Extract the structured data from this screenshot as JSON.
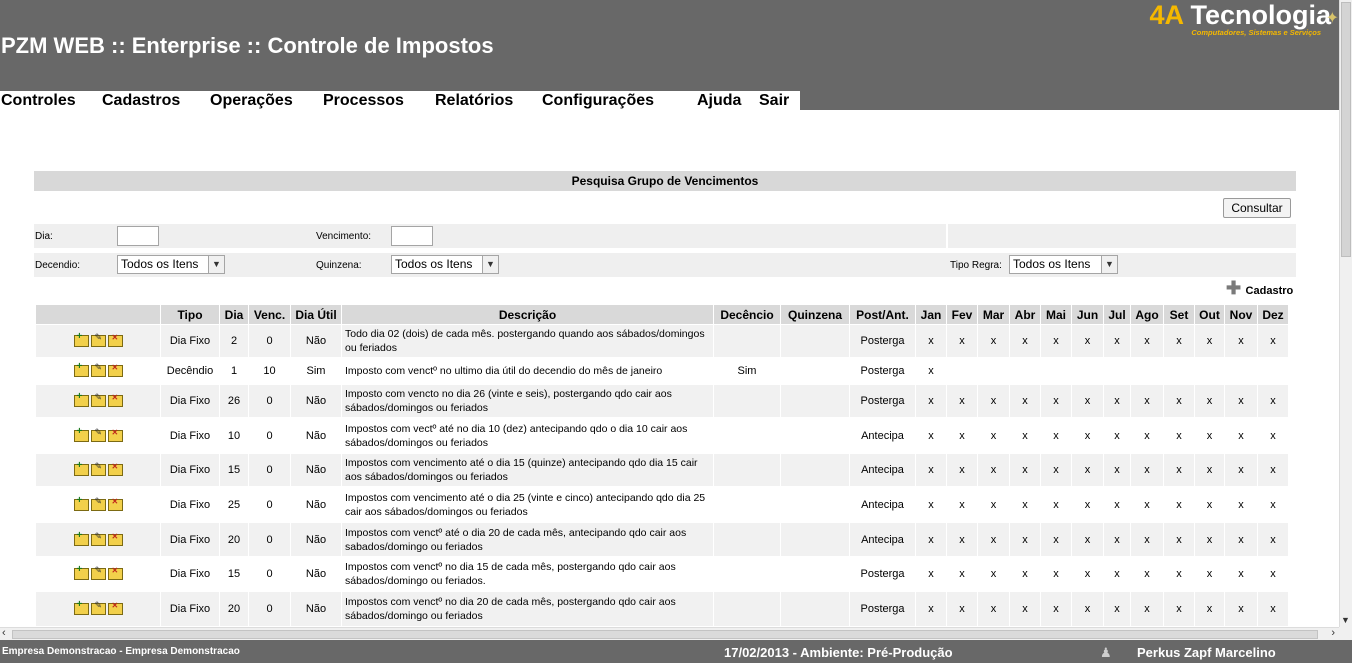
{
  "header": {
    "app_title": "PZM WEB :: Enterprise :: Controle de Impostos",
    "logo_prefix": "4A",
    "logo_name": "Tecnologia",
    "logo_tagline": "Computadores, Sistemas e Serviços"
  },
  "menu": [
    "Controles",
    "Cadastros",
    "Operações",
    "Processos",
    "Relatórios",
    "Configurações",
    "Ajuda",
    "Sair"
  ],
  "panel": {
    "title": "Pesquisa Grupo de Vencimentos",
    "consultar_label": "Consultar",
    "cadastro_label": "Cadastro"
  },
  "filters": {
    "dia_label": "Dia:",
    "dia_value": "",
    "vencimento_label": "Vencimento:",
    "vencimento_value": "",
    "decendio_label": "Decendio:",
    "decendio_value": "Todos os Itens",
    "quinzena_label": "Quinzena:",
    "quinzena_value": "Todos os Itens",
    "tipo_regra_label": "Tipo Regra:",
    "tipo_regra_value": "Todos os Itens"
  },
  "table": {
    "columns": [
      "",
      "Tipo",
      "Dia",
      "Venc.",
      "Dia Útil",
      "Descrição",
      "Decêncio",
      "Quinzena",
      "Post/Ant.",
      "Jan",
      "Fev",
      "Mar",
      "Abr",
      "Mai",
      "Jun",
      "Jul",
      "Ago",
      "Set",
      "Out",
      "Nov",
      "Dez"
    ],
    "rows": [
      {
        "tipo": "Dia Fixo",
        "dia": "2",
        "venc": "0",
        "dia_util": "Não",
        "desc": "Todo dia 02 (dois) de cada mês. postergando quando aos sábados/domingos ou feriados",
        "decendio": "",
        "quinzena": "",
        "post_ant": "Posterga",
        "months": [
          "x",
          "x",
          "x",
          "x",
          "x",
          "x",
          "x",
          "x",
          "x",
          "x",
          "x",
          "x"
        ]
      },
      {
        "tipo": "Decêndio",
        "dia": "1",
        "venc": "10",
        "dia_util": "Sim",
        "desc": "Imposto com venctº no ultimo dia útil do decendio do mês de janeiro",
        "decendio": "Sim",
        "quinzena": "",
        "post_ant": "Posterga",
        "months": [
          "x",
          "",
          "",
          "",
          "",
          "",
          "",
          "",
          "",
          "",
          "",
          ""
        ]
      },
      {
        "tipo": "Dia Fixo",
        "dia": "26",
        "venc": "0",
        "dia_util": "Não",
        "desc": "Imposto com vencto no dia 26 (vinte e seis), postergando qdo cair aos sábados/domingos ou feriados",
        "decendio": "",
        "quinzena": "",
        "post_ant": "Posterga",
        "months": [
          "x",
          "x",
          "x",
          "x",
          "x",
          "x",
          "x",
          "x",
          "x",
          "x",
          "x",
          "x"
        ]
      },
      {
        "tipo": "Dia Fixo",
        "dia": "10",
        "venc": "0",
        "dia_util": "Não",
        "desc": "Impostos com vectº até no dia 10 (dez) antecipando qdo o dia 10 cair aos sábados/domingos ou feriados",
        "decendio": "",
        "quinzena": "",
        "post_ant": "Antecipa",
        "months": [
          "x",
          "x",
          "x",
          "x",
          "x",
          "x",
          "x",
          "x",
          "x",
          "x",
          "x",
          "x"
        ]
      },
      {
        "tipo": "Dia Fixo",
        "dia": "15",
        "venc": "0",
        "dia_util": "Não",
        "desc": "Impostos com vencimento até o dia 15 (quinze) antecipando qdo dia 15 cair aos sábados/domingos ou feriados",
        "decendio": "",
        "quinzena": "",
        "post_ant": "Antecipa",
        "months": [
          "x",
          "x",
          "x",
          "x",
          "x",
          "x",
          "x",
          "x",
          "x",
          "x",
          "x",
          "x"
        ]
      },
      {
        "tipo": "Dia Fixo",
        "dia": "25",
        "venc": "0",
        "dia_util": "Não",
        "desc": "Impostos com vencimento até o dia 25 (vinte e cinco) antecipando qdo dia 25 cair aos sábados/domingos ou feriados",
        "decendio": "",
        "quinzena": "",
        "post_ant": "Antecipa",
        "months": [
          "x",
          "x",
          "x",
          "x",
          "x",
          "x",
          "x",
          "x",
          "x",
          "x",
          "x",
          "x"
        ]
      },
      {
        "tipo": "Dia Fixo",
        "dia": "20",
        "venc": "0",
        "dia_util": "Não",
        "desc": "Impostos com venctº até o dia 20 de cada mês, antecipando qdo cair aos sabados/domingo ou feriados",
        "decendio": "",
        "quinzena": "",
        "post_ant": "Antecipa",
        "months": [
          "x",
          "x",
          "x",
          "x",
          "x",
          "x",
          "x",
          "x",
          "x",
          "x",
          "x",
          "x"
        ]
      },
      {
        "tipo": "Dia Fixo",
        "dia": "15",
        "venc": "0",
        "dia_util": "Não",
        "desc": "Impostos com venctº no dia 15 de cada mês, postergando qdo cair aos sábados/domingo ou feriados.",
        "decendio": "",
        "quinzena": "",
        "post_ant": "Posterga",
        "months": [
          "x",
          "x",
          "x",
          "x",
          "x",
          "x",
          "x",
          "x",
          "x",
          "x",
          "x",
          "x"
        ]
      },
      {
        "tipo": "Dia Fixo",
        "dia": "20",
        "venc": "0",
        "dia_util": "Não",
        "desc": "Impostos com venctº no dia 20 de cada mês, postergando qdo cair aos sábados/domingo ou feriados",
        "decendio": "",
        "quinzena": "",
        "post_ant": "Posterga",
        "months": [
          "x",
          "x",
          "x",
          "x",
          "x",
          "x",
          "x",
          "x",
          "x",
          "x",
          "x",
          "x"
        ]
      }
    ]
  },
  "status": {
    "company": "Empresa Demonstracao - Empresa Demonstracao",
    "environment": "17/02/2013 - Ambiente: Pré-Produção",
    "user": "Perkus Zapf Marcelino"
  }
}
